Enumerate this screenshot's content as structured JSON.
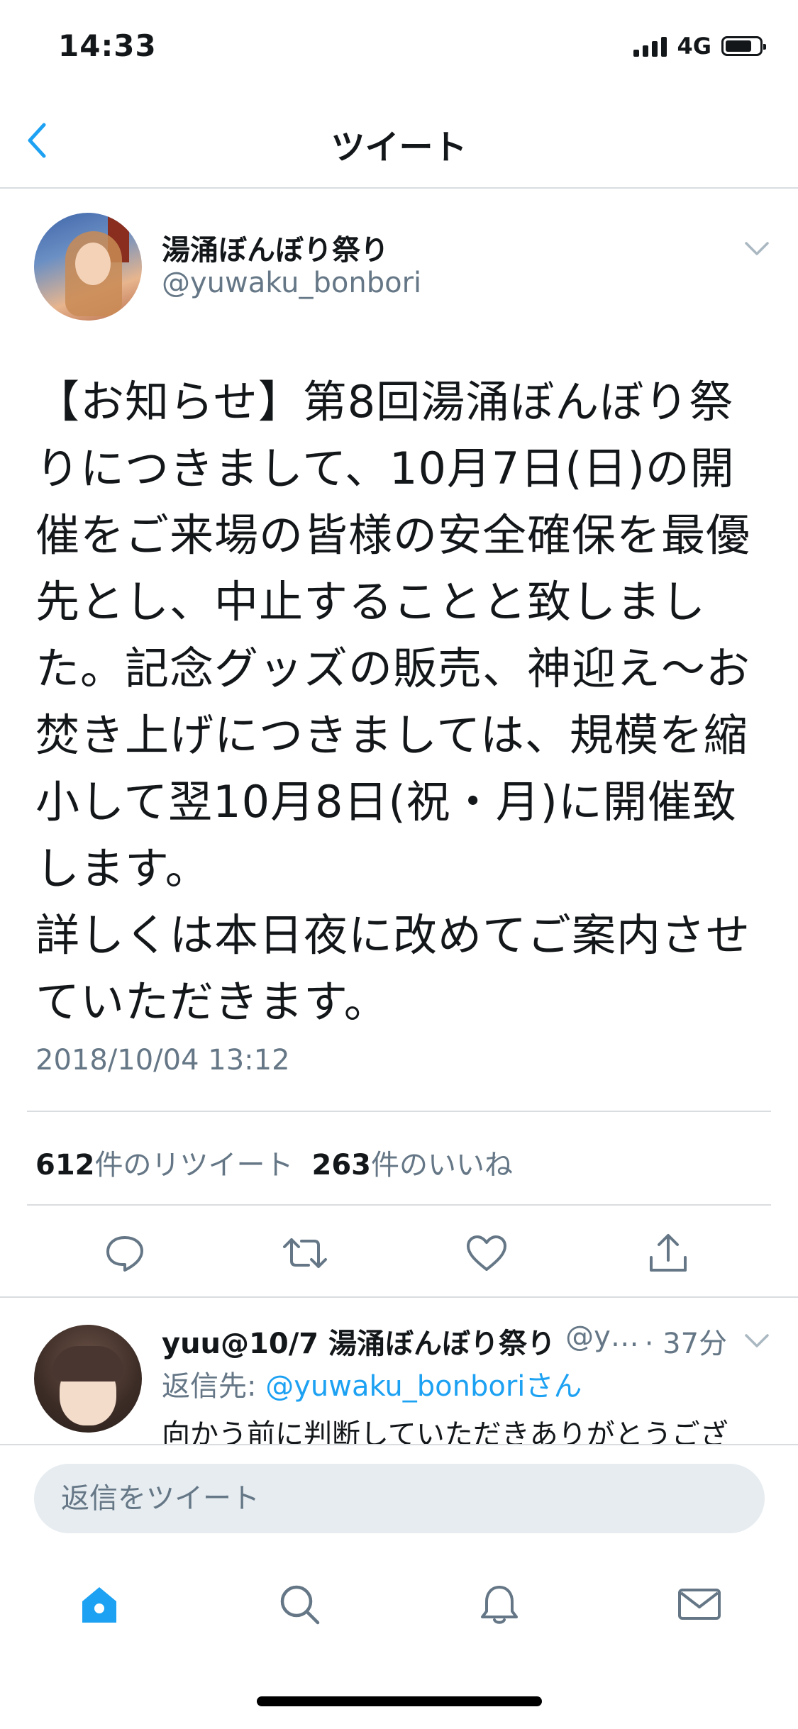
{
  "status_bar": {
    "time": "14:33",
    "network": "4G"
  },
  "nav": {
    "title": "ツイート"
  },
  "author": {
    "name": "湯涌ぼんぼり祭り",
    "handle": "@yuwaku_bonbori"
  },
  "tweet": {
    "text": "【お知らせ】第8回湯涌ぼんぼり祭りにつきまして、10月7日(日)の開催をご来場の皆様の安全確保を最優先とし、中止することと致しました。記念グッズの販売、神迎え〜お焚き上げにつきましては、規模を縮小して翌10月8日(祝・月)に開催致します。\n詳しくは本日夜に改めてご案内させていただきます。",
    "timestamp": "2018/10/04 13:12"
  },
  "stats": {
    "retweets_count": "612",
    "retweets_label": "件のリツイート",
    "likes_count": "263",
    "likes_label": "件のいいね"
  },
  "actions": [
    {
      "icon": "reply-icon"
    },
    {
      "icon": "retweet-icon"
    },
    {
      "icon": "like-icon"
    },
    {
      "icon": "share-icon"
    }
  ],
  "reply": {
    "name": "yuu@10/7 湯涌ぼんぼり祭り",
    "handle_truncated": "@y…",
    "time": "· 37分",
    "reply_to_prefix": "返信先: ",
    "reply_to_handle": "@yuwaku_bonbori",
    "reply_to_suffix": "さん",
    "text": "向かう前に判断していただきありがとうござ"
  },
  "composer": {
    "placeholder": "返信をツイート"
  },
  "tabbar": [
    {
      "icon": "home-icon",
      "active": true
    },
    {
      "icon": "search-icon",
      "active": false
    },
    {
      "icon": "notifications-icon",
      "active": false
    },
    {
      "icon": "messages-icon",
      "active": false
    }
  ],
  "colors": {
    "accent": "#1da1f2",
    "secondary_text": "#657786",
    "text": "#14171a",
    "divider": "#d9dde0"
  }
}
